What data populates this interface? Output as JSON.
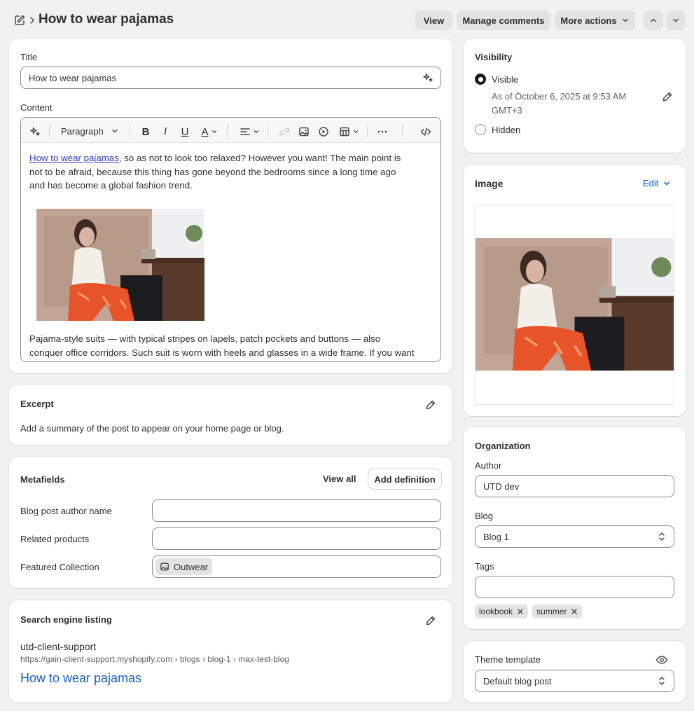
{
  "header": {
    "title": "How to wear pajamas",
    "view_label": "View",
    "manage_comments_label": "Manage comments",
    "more_actions_label": "More actions"
  },
  "title_card": {
    "title_label": "Title",
    "title_value": "How to wear pajamas",
    "content_label": "Content",
    "format_select": "Paragraph",
    "body_link": "How to wear pajamas",
    "body_p1_rest_line1": ", so as not to look too relaxed? However you want! The main point is",
    "body_p1_line2": "not to be afraid, because this thing has gone beyond the bedrooms since a long time ago",
    "body_p1_line3": "and has become a global fashion trend.",
    "body_p2_line1": "Pajama-style suits — with typical stripes on lapels, patch pockets and buttons — also",
    "body_p2_line2": "conquer office corridors. Such suit is worn with heels and glasses in a wide frame. If you want"
  },
  "excerpt": {
    "heading": "Excerpt",
    "text": "Add a summary of the post to appear on your home page or blog."
  },
  "metafields": {
    "heading": "Metafields",
    "view_all_label": "View all",
    "add_definition_label": "Add definition",
    "rows": [
      {
        "label": "Blog post author name",
        "value": ""
      },
      {
        "label": "Related products",
        "value": ""
      },
      {
        "label": "Featured Collection",
        "value": "Outwear"
      }
    ]
  },
  "seo": {
    "heading": "Search engine listing",
    "store_name": "utd-client-support",
    "url": "https://gain-client-support.myshopify.com › blogs › blog-1 › max-test-blog",
    "title": "How to wear pajamas"
  },
  "visibility": {
    "heading": "Visibility",
    "visible_label": "Visible",
    "as_of_line1": "As of October 6, 2025 at 9:53 AM",
    "as_of_line2": "GMT+3",
    "hidden_label": "Hidden",
    "selected": "Visible"
  },
  "image_card": {
    "heading": "Image",
    "edit_label": "Edit"
  },
  "organization": {
    "heading": "Organization",
    "author_label": "Author",
    "author_value": "UTD dev",
    "blog_label": "Blog",
    "blog_value": "Blog 1",
    "tags_label": "Tags",
    "tags": [
      "lookbook",
      "summer"
    ]
  },
  "theme": {
    "heading": "Theme template",
    "value": "Default blog post"
  },
  "colors": {
    "link_blue": "#005bd3",
    "seo_title_blue": "#1a5fbf",
    "page_bg": "#f1f1f1"
  }
}
